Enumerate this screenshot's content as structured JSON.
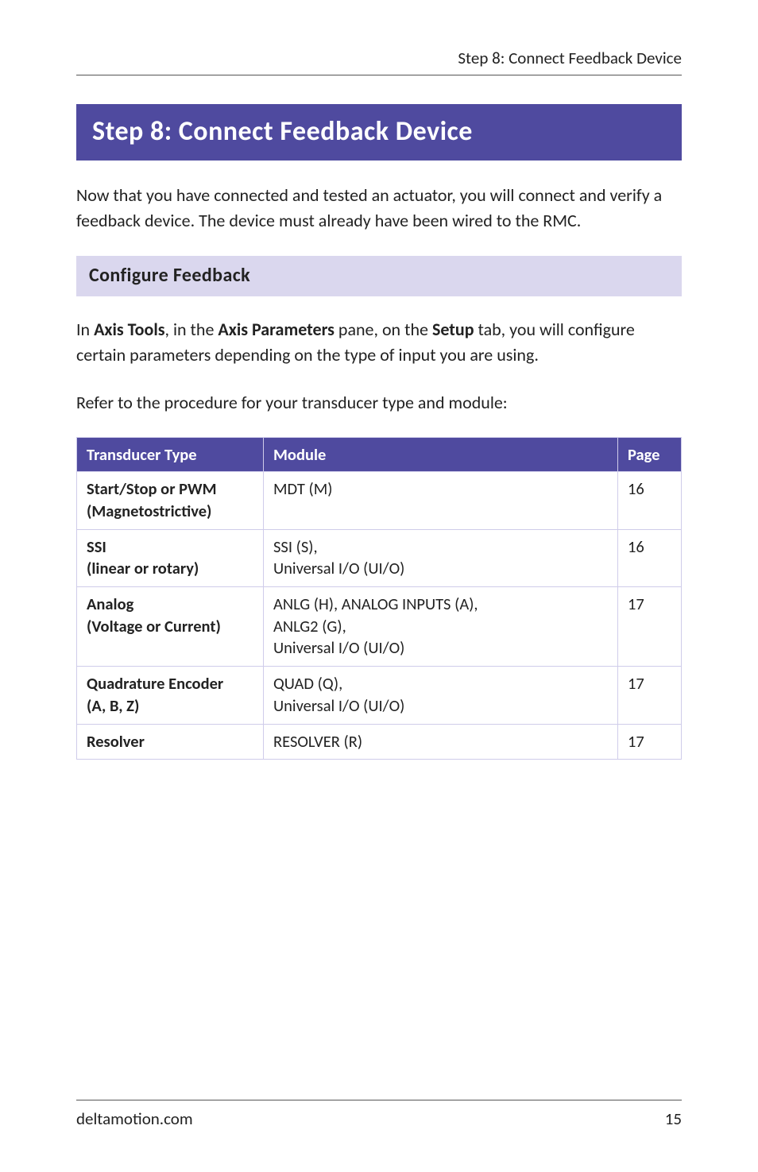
{
  "running_head": "Step 8: Connect Feedback Device",
  "banner_title": "Step 8: Connect Feedback Device",
  "intro": "Now that you have connected and tested an actuator, you will connect and verify a feedback device. The device must already have been wired to the RMC.",
  "sub_heading": "Configure Feedback",
  "configure_para": {
    "t0": "In ",
    "b0": "Axis Tools",
    "t1": ", in the ",
    "b1": "Axis Parameters",
    "t2": " pane, on the ",
    "b2": "Setup",
    "t3": " tab, you will configure certain parameters depending on the type of input you are using."
  },
  "refer_line": "Refer to the procedure for your transducer type and module:",
  "table": {
    "headers": {
      "type": "Transducer Type",
      "module": "Module",
      "page": "Page"
    },
    "rows": [
      {
        "type_l1": "Start/Stop or PWM",
        "type_l2": "(Magnetostrictive)",
        "module_l1": "MDT (M)",
        "module_l2": "",
        "module_l3": "",
        "page": "16"
      },
      {
        "type_l1": "SSI",
        "type_l2": "(linear or rotary)",
        "module_l1": "SSI (S),",
        "module_l2": "Universal I/O (UI/O)",
        "module_l3": "",
        "page": "16"
      },
      {
        "type_l1": "Analog",
        "type_l2": "(Voltage or Current)",
        "module_l1": "ANLG (H), ANALOG INPUTS (A),",
        "module_l2": "ANLG2 (G),",
        "module_l3": "Universal I/O (UI/O)",
        "page": "17"
      },
      {
        "type_l1": "Quadrature Encoder",
        "type_l2": "(A, B, Z)",
        "module_l1": "QUAD (Q),",
        "module_l2": "Universal I/O (UI/O)",
        "module_l3": "",
        "page": "17"
      },
      {
        "type_l1": "Resolver",
        "type_l2": "",
        "module_l1": "RESOLVER (R)",
        "module_l2": "",
        "module_l3": "",
        "page": "17"
      }
    ]
  },
  "footer": {
    "site": "deltamotion.com",
    "page_num": "15"
  }
}
